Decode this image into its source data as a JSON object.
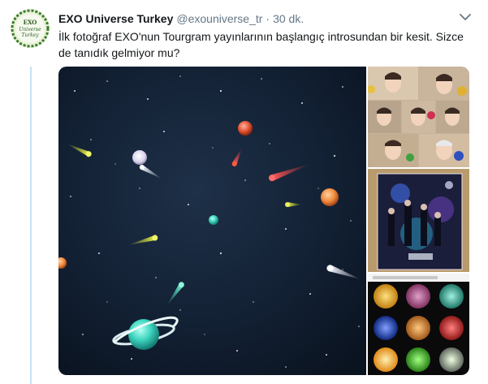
{
  "tweet": {
    "display_name": "EXO Universe Turkey",
    "handle": "@exouniverse_tr",
    "separator": "·",
    "time": "30 dk.",
    "text": "İlk fotoğraf EXO'nun Tourgram yayınlarının başlangıç introsundan bir kesit. Sizce de tanıdık gelmiyor mu?"
  },
  "avatar": {
    "line1": "EXO",
    "line2": "Universe",
    "line3": "Turkey",
    "bg_color": "#e8f1d8",
    "ring_color": "#3a7d2c"
  },
  "colors": {
    "thread_line": "#c4e4f4",
    "space_bg": "#0b1524",
    "muted": "#657786"
  },
  "icons": {
    "menu": "chevron-down-icon"
  }
}
